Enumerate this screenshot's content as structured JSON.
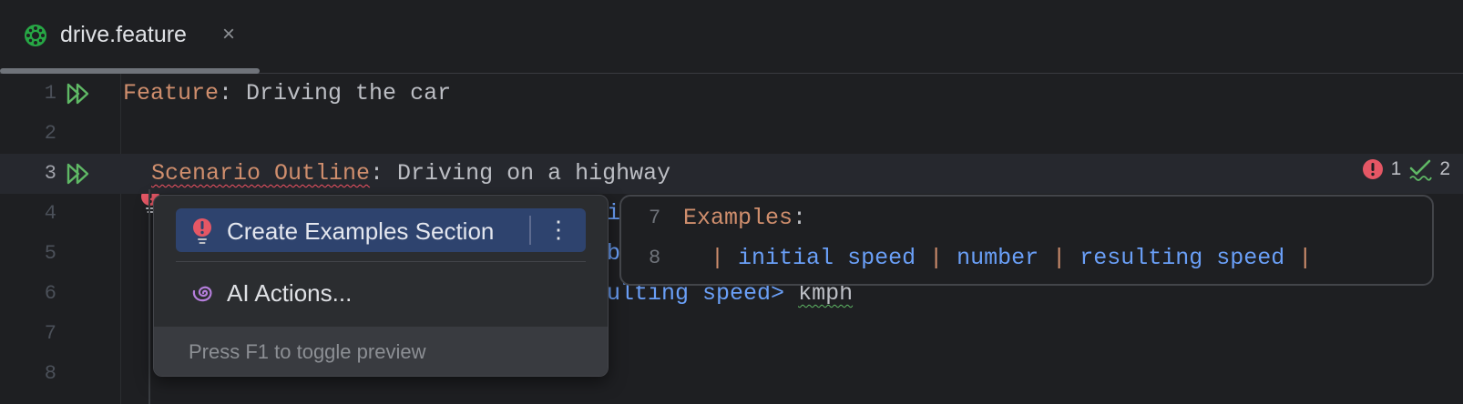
{
  "tab": {
    "title": "drive.feature",
    "close_glyph": "×",
    "icon": "cucumber-icon"
  },
  "status": {
    "errors": "1",
    "weak_warnings": "2"
  },
  "lines": [
    {
      "num": "1",
      "keyword": "Feature",
      "text": ": Driving the car"
    },
    {
      "num": "2"
    },
    {
      "num": "3",
      "keyword": "Scenario Outline",
      "text": ": Driving on a highway"
    },
    {
      "num": "4",
      "visible_tail": "i"
    },
    {
      "num": "5",
      "visible_tail": "b"
    },
    {
      "num": "6",
      "param_tail": "ulting speed>",
      "text_tail": " ",
      "unit": "kmph"
    },
    {
      "num": "7"
    },
    {
      "num": "8"
    }
  ],
  "popup": {
    "primary_action": "Create Examples Section",
    "more_glyph": "⋮",
    "secondary_action": "AI Actions...",
    "footer": "Press F1 to toggle preview"
  },
  "preview": {
    "line7": {
      "num": "7",
      "keyword": "Examples",
      "colon": ":"
    },
    "line8": {
      "num": "8",
      "pipe": "|",
      "cells": [
        "initial speed",
        "number",
        "resulting speed"
      ]
    }
  },
  "colors": {
    "keyword": "#cf8e6d",
    "param": "#6a9ff7",
    "error": "#e55765",
    "run": "#5fb865",
    "selection": "#2e436e"
  }
}
